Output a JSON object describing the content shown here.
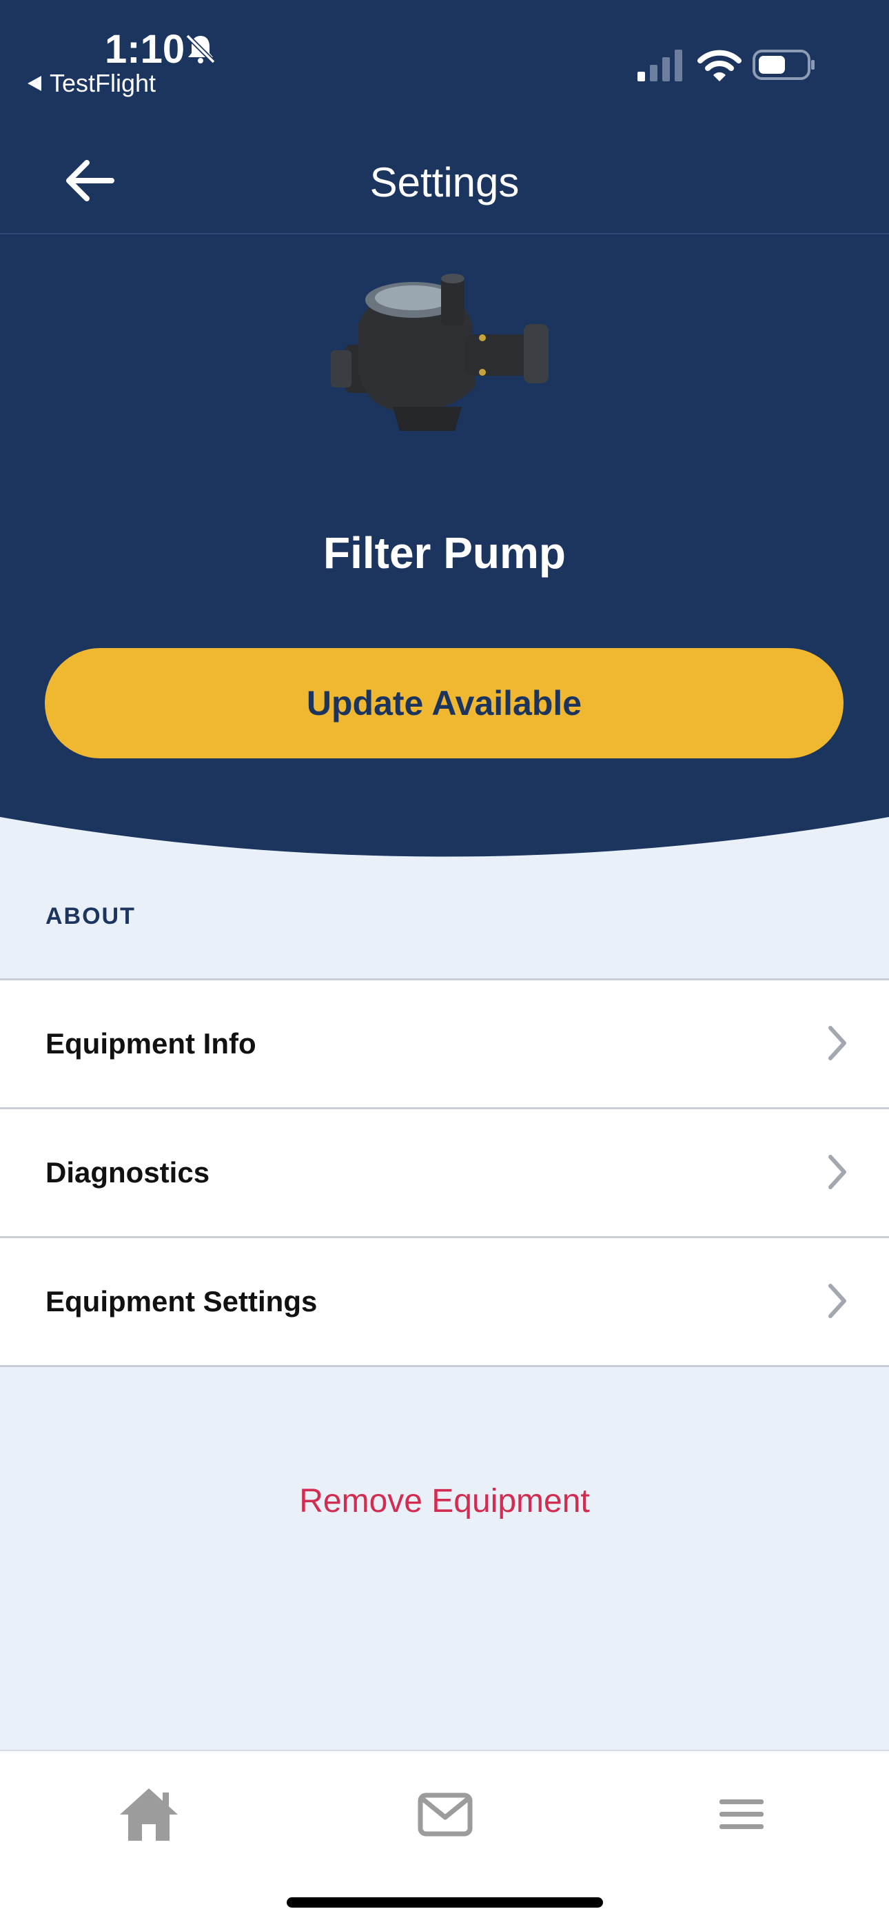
{
  "status_bar": {
    "time": "1:10",
    "back_app": "TestFlight"
  },
  "nav": {
    "title": "Settings"
  },
  "device": {
    "name": "Filter Pump",
    "update_label": "Update Available"
  },
  "about": {
    "header": "ABOUT",
    "items": [
      {
        "label": "Equipment Info"
      },
      {
        "label": "Diagnostics"
      },
      {
        "label": "Equipment Settings"
      }
    ]
  },
  "remove_label": "Remove Equipment",
  "tabs": [
    {
      "icon": "home-icon"
    },
    {
      "icon": "mail-icon"
    },
    {
      "icon": "menu-icon"
    }
  ],
  "colors": {
    "primary_navy": "#1b355e",
    "accent_yellow": "#f0b731",
    "destructive_red": "#d22d50",
    "background": "#e9f0f8"
  }
}
